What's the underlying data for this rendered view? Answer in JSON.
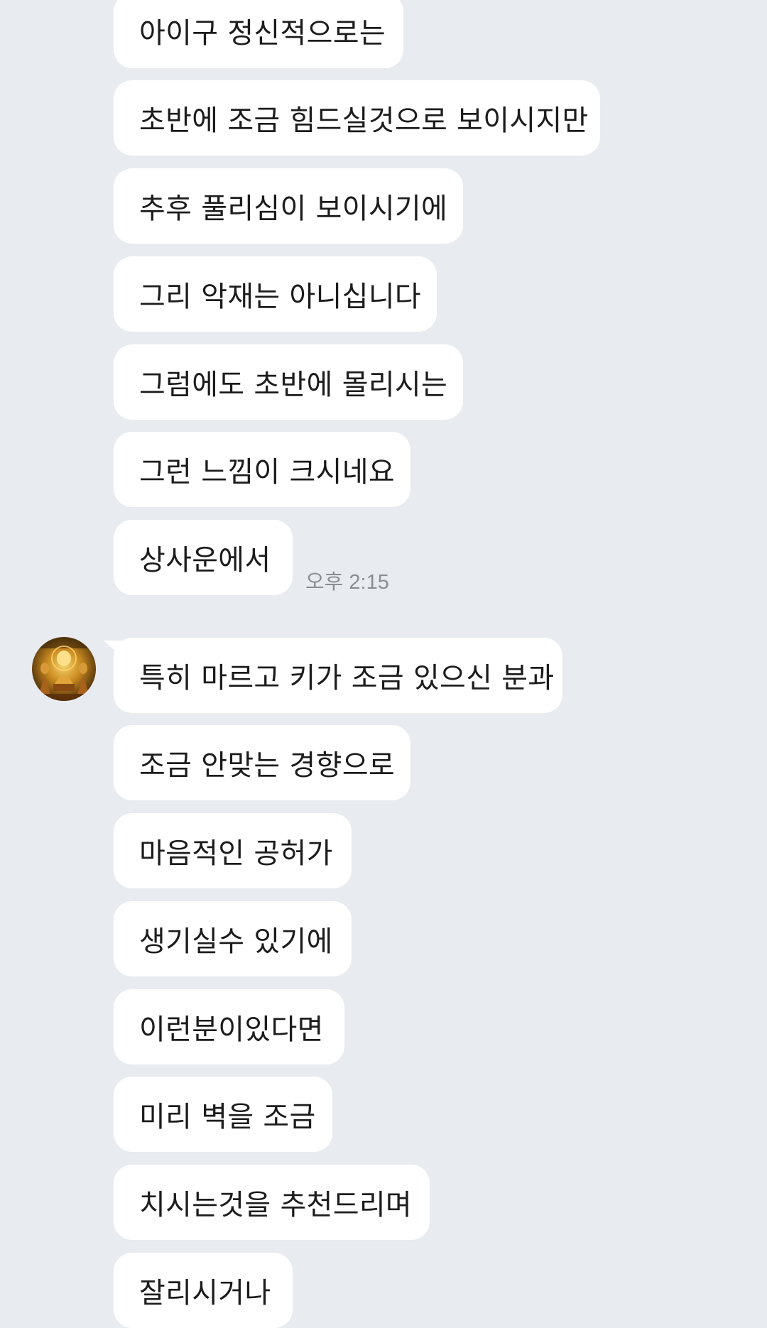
{
  "messages_group1": [
    "아이구 정신적으로는",
    "초반에 조금 힘드실것으로 보이시지만",
    "추후 풀리심이 보이시기에",
    "그리 악재는 아니십니다",
    "그럼에도 초반에 몰리시는",
    "그런 느낌이 크시네요",
    "상사운에서"
  ],
  "timestamp": "오후 2:15",
  "messages_group2": [
    "특히 마르고 키가 조금 있으신 분과",
    "조금 안맞는 경향으로",
    "마음적인 공허가",
    "생기실수 있기에",
    "이런분이있다면",
    "미리 벽을 조금",
    "치시는것을 추천드리며",
    "잘리시거나"
  ],
  "colors": {
    "background": "#e8ebef",
    "bubble": "#ffffff",
    "text": "#1c1c1c",
    "timestamp": "#8a8d93"
  },
  "icons": {
    "sender_avatar": "avatar-image"
  }
}
